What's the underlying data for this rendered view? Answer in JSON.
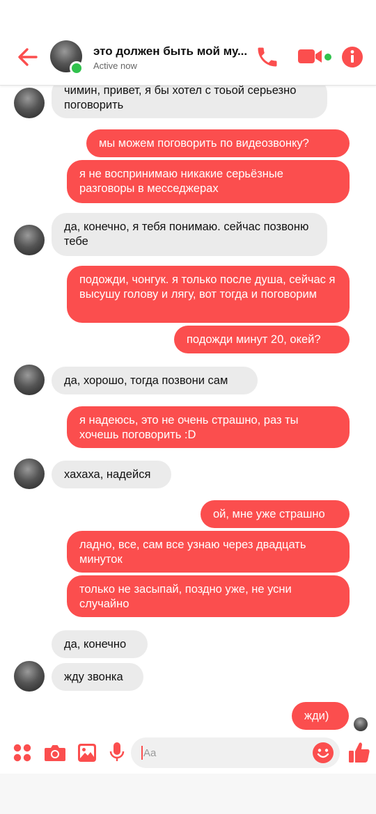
{
  "header": {
    "title": "это должен быть мой му...",
    "status": "Active now",
    "accent_color": "#fb4e4e",
    "online_color": "#31c24d",
    "icons": [
      "arrow-left-icon",
      "phone-icon",
      "video-camera-icon",
      "info-icon"
    ]
  },
  "messages": [
    {
      "from": "them",
      "text": "чимин, привет, я бы хотел с тоьой серьезно поговорить"
    },
    {
      "from": "me",
      "text": "мы можем поговорить по видеозвонку?"
    },
    {
      "from": "me",
      "text": "я не воспринимаю никакие серьёзные разговоры в месседжерах"
    },
    {
      "from": "them",
      "text": "да, конечно, я тебя понимаю. сейчас позвоню тебе"
    },
    {
      "from": "me",
      "text": "подожди, чонгук. я только после душа, сейчас я высушу голову и лягу, вот тогда и поговорим"
    },
    {
      "from": "me",
      "text": "подожди минут 20, окей?"
    },
    {
      "from": "them",
      "text": "да, хорошо, тогда позвони сам"
    },
    {
      "from": "me",
      "text": "я надеюсь, это не очень страшно, раз ты хочешь поговорить :D"
    },
    {
      "from": "them",
      "text": "хахаха, надейся"
    },
    {
      "from": "me",
      "text": "ой, мне уже страшно"
    },
    {
      "from": "me",
      "text": "ладно, все, сам все узнаю через двадцать минуток"
    },
    {
      "from": "me",
      "text": "только не засыпай, поздно уже, не усни случайно"
    },
    {
      "from": "them",
      "text": "да, конечно"
    },
    {
      "from": "them",
      "text": "жду звонка"
    },
    {
      "from": "me",
      "text": "жди)"
    }
  ],
  "composer": {
    "placeholder": "Aa",
    "icons": [
      "grid-icon",
      "camera-icon",
      "image-icon",
      "microphone-icon",
      "emoji-icon",
      "thumbs-up-icon"
    ]
  }
}
